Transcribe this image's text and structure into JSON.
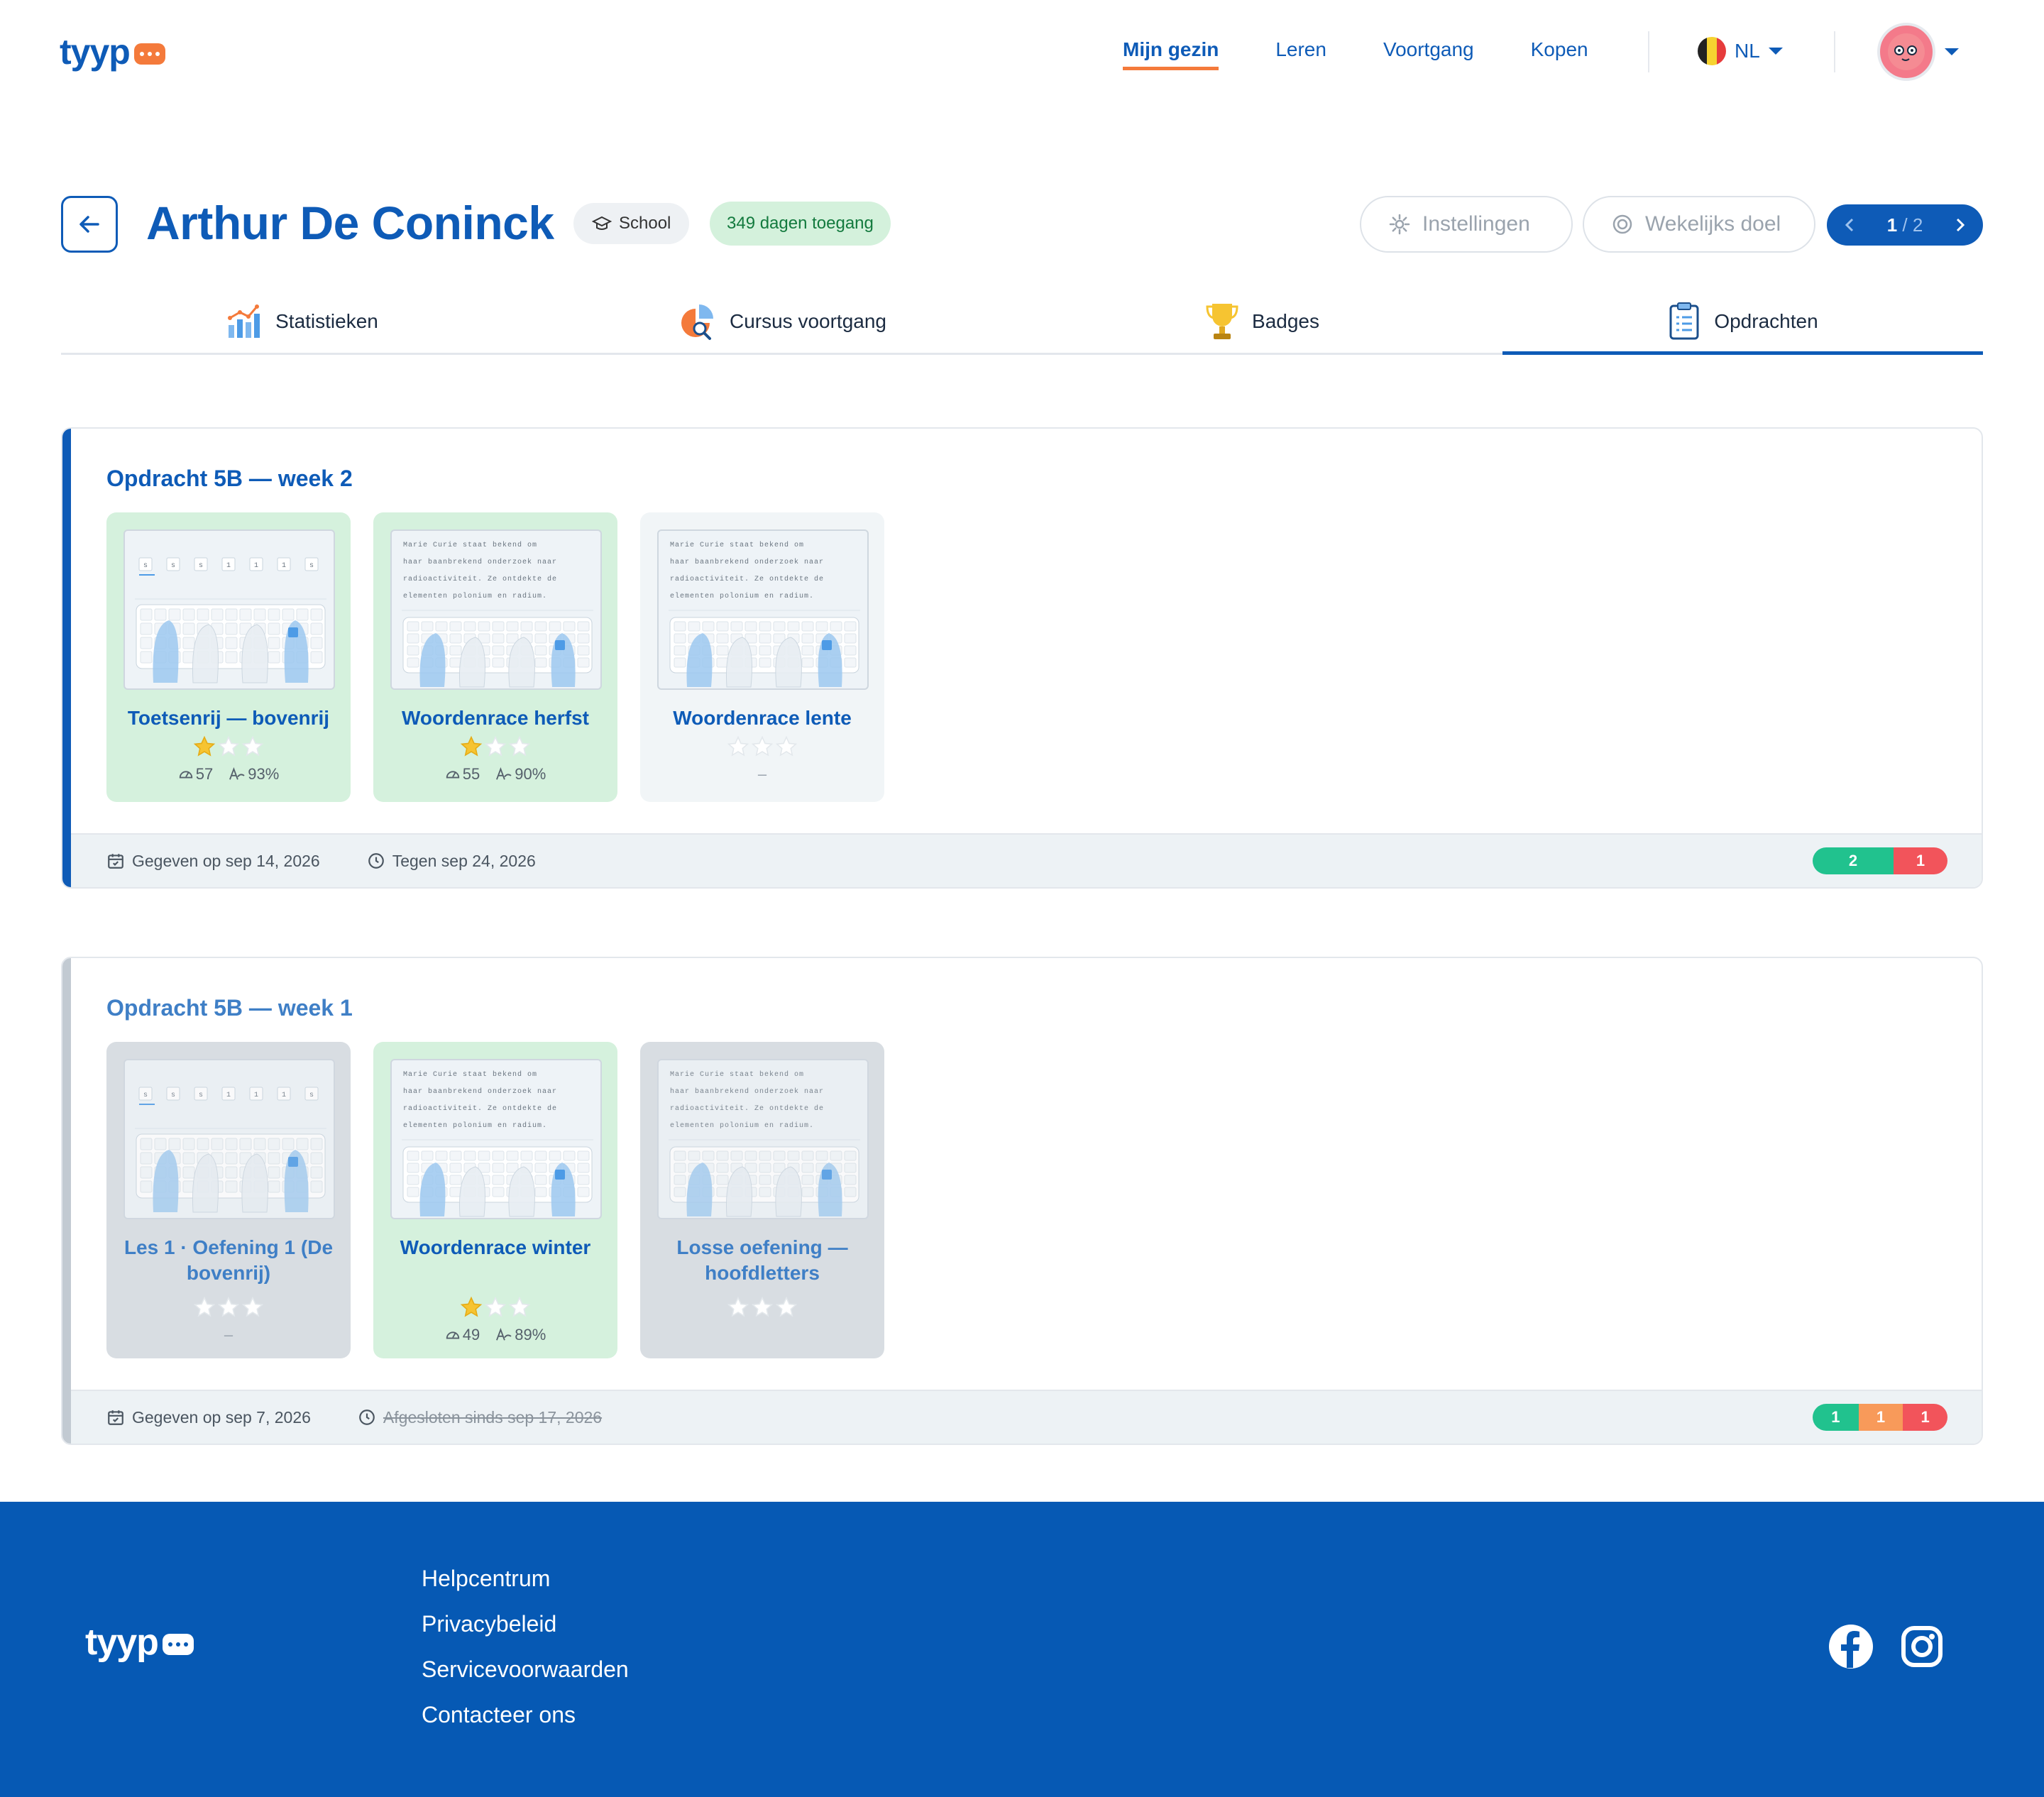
{
  "header": {
    "logo": "tyyp",
    "nav": [
      {
        "label": "Mijn gezin",
        "active": true
      },
      {
        "label": "Leren",
        "active": false
      },
      {
        "label": "Voortgang",
        "active": false
      },
      {
        "label": "Kopen",
        "active": false
      }
    ],
    "language": "NL",
    "flag_colors": [
      "#222222",
      "#f6d330",
      "#e63b3b"
    ],
    "avatar_icon": "avatar-icon"
  },
  "student": {
    "name": "Arthur De Coninck",
    "type_badge": "School",
    "access_badge": "349 dagen toegang"
  },
  "actions": {
    "settings": "Instellingen",
    "weekly_goal": "Wekelijks doel",
    "pager": {
      "current": "1",
      "total": "/ 2"
    }
  },
  "tabs": [
    {
      "label": "Statistieken",
      "icon": "bar-chart-icon"
    },
    {
      "label": "Cursus voortgang",
      "icon": "pie-chart-icon"
    },
    {
      "label": "Badges",
      "icon": "trophy-icon"
    },
    {
      "label": "Opdrachten",
      "icon": "clipboard-icon",
      "active": true
    }
  ],
  "assignments": [
    {
      "title": "Opdracht 5B — week 2",
      "accent": "#0e5bb7",
      "tiles": [
        {
          "title": "Toetsenrij — bovenrij",
          "stars": 1,
          "speed": "57",
          "accuracy": "93%",
          "status": "green",
          "thumb": "keys"
        },
        {
          "title": "Woordenrace herfst",
          "stars": 1,
          "speed": "55",
          "accuracy": "90%",
          "status": "green",
          "thumb": "text"
        },
        {
          "title": "Woordenrace lente",
          "stars": 0,
          "empty": "–",
          "status": "open",
          "thumb": "text"
        }
      ],
      "given": "Gegeven op sep 14, 2026",
      "due": "Tegen sep 24, 2026",
      "progress": [
        {
          "value": "2",
          "color": "#21c28e",
          "share": 0.6
        },
        {
          "value": "1",
          "color": "#f2545b",
          "share": 0.4
        }
      ]
    },
    {
      "title": "Opdracht 5B — week 1",
      "accent": "#c2cad2",
      "tiles": [
        {
          "title": "Les 1 · Oefening 1 (De bovenrij)",
          "stars": 0,
          "empty": "–",
          "status": "grey",
          "thumb": "keys"
        },
        {
          "title": "Woordenrace winter",
          "stars": 1,
          "speed": "49",
          "accuracy": "89%",
          "status": "green",
          "thumb": "text"
        },
        {
          "title": "Losse oefening — hoofdletters",
          "stars": 0,
          "status": "grey",
          "thumb": "text"
        }
      ],
      "given": "Gegeven op sep 7, 2026",
      "due": "Afgesloten sinds sep 17, 2026",
      "progress": [
        {
          "value": "1",
          "color": "#21c28e",
          "share": 0.34
        },
        {
          "value": "1",
          "color": "#f89a5a",
          "share": 0.33
        },
        {
          "value": "1",
          "color": "#f2545b",
          "share": 0.33
        }
      ]
    }
  ],
  "thumb_text": [
    "Marie Curie staat bekend om",
    "haar baanbrekend onderzoek naar",
    "radioactiviteit. Ze ontdekte de",
    "elementen polonium en radium."
  ],
  "thumb_keys": [
    "s",
    "s",
    "s",
    "1",
    "1",
    "1",
    "s"
  ],
  "footer": {
    "logo": "tyyp",
    "links": [
      "Helpcentrum",
      "Privacybeleid",
      "Servicevoorwaarden",
      "Contacteer ons"
    ],
    "social": [
      "facebook-icon",
      "instagram-icon"
    ]
  }
}
